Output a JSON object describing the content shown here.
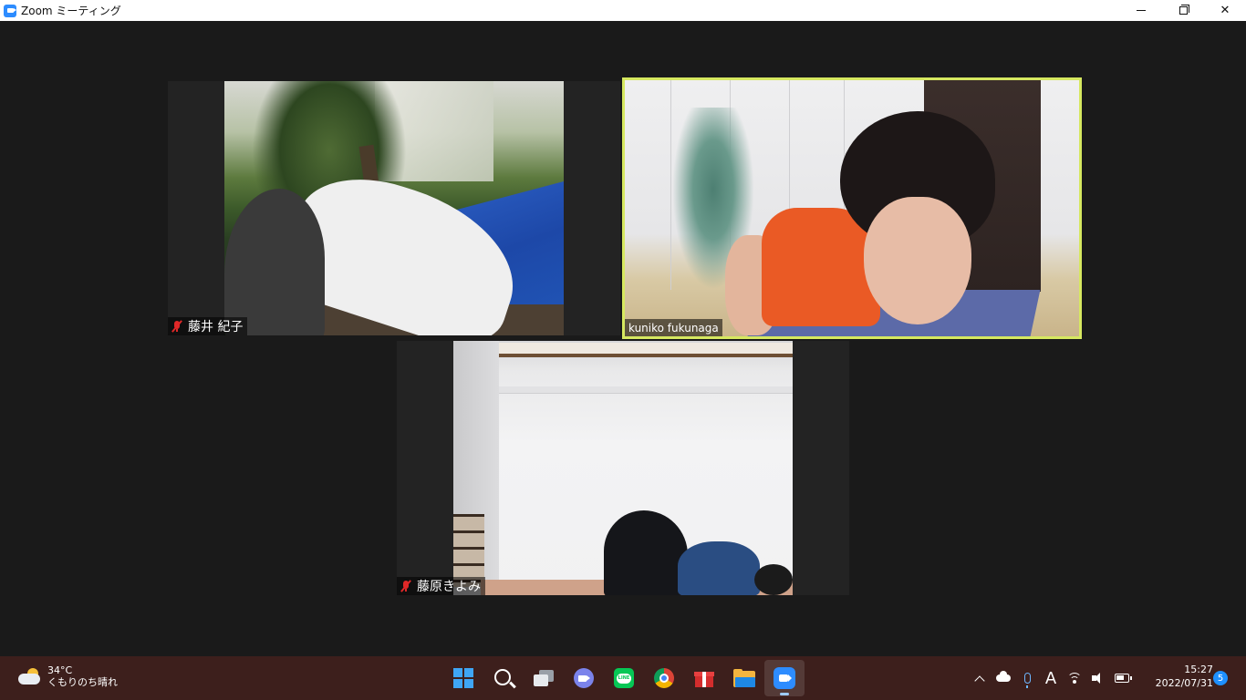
{
  "window": {
    "title": "Zoom ミーティング",
    "icon": "zoom-icon",
    "controls": [
      "minimize-icon",
      "restore-icon",
      "close-icon"
    ]
  },
  "meeting": {
    "participants": [
      {
        "name": "藤井 紀子",
        "muted": true,
        "active_speaker": false
      },
      {
        "name": "kuniko fukunaga",
        "muted": false,
        "active_speaker": true
      },
      {
        "name": "藤原きよみ",
        "muted": true,
        "active_speaker": false
      }
    ],
    "active_speaker_border_color": "#d6e860"
  },
  "taskbar": {
    "weather": {
      "temperature": "34°C",
      "condition": "くもりのち晴れ",
      "icon": "partly-cloudy-icon"
    },
    "apps": [
      {
        "name": "start-button",
        "icon": "windows-logo-icon"
      },
      {
        "name": "search-button",
        "icon": "search-icon"
      },
      {
        "name": "task-view-button",
        "icon": "task-view-icon"
      },
      {
        "name": "teams-chat-button",
        "icon": "teams-icon"
      },
      {
        "name": "line-app",
        "icon": "line-icon"
      },
      {
        "name": "chrome-app",
        "icon": "chrome-icon"
      },
      {
        "name": "gift-app",
        "icon": "gift-icon"
      },
      {
        "name": "file-explorer-app",
        "icon": "folder-icon"
      },
      {
        "name": "zoom-app",
        "icon": "zoom-icon",
        "active": true
      }
    ],
    "tray": {
      "ime_mode": "A",
      "icons": [
        "chevron-up-icon",
        "onedrive-icon",
        "microphone-icon",
        "ime-icon",
        "wifi-icon",
        "speaker-icon",
        "battery-icon"
      ]
    },
    "clock": {
      "time": "15:27",
      "date": "2022/07/31"
    },
    "notification_count": "5"
  }
}
